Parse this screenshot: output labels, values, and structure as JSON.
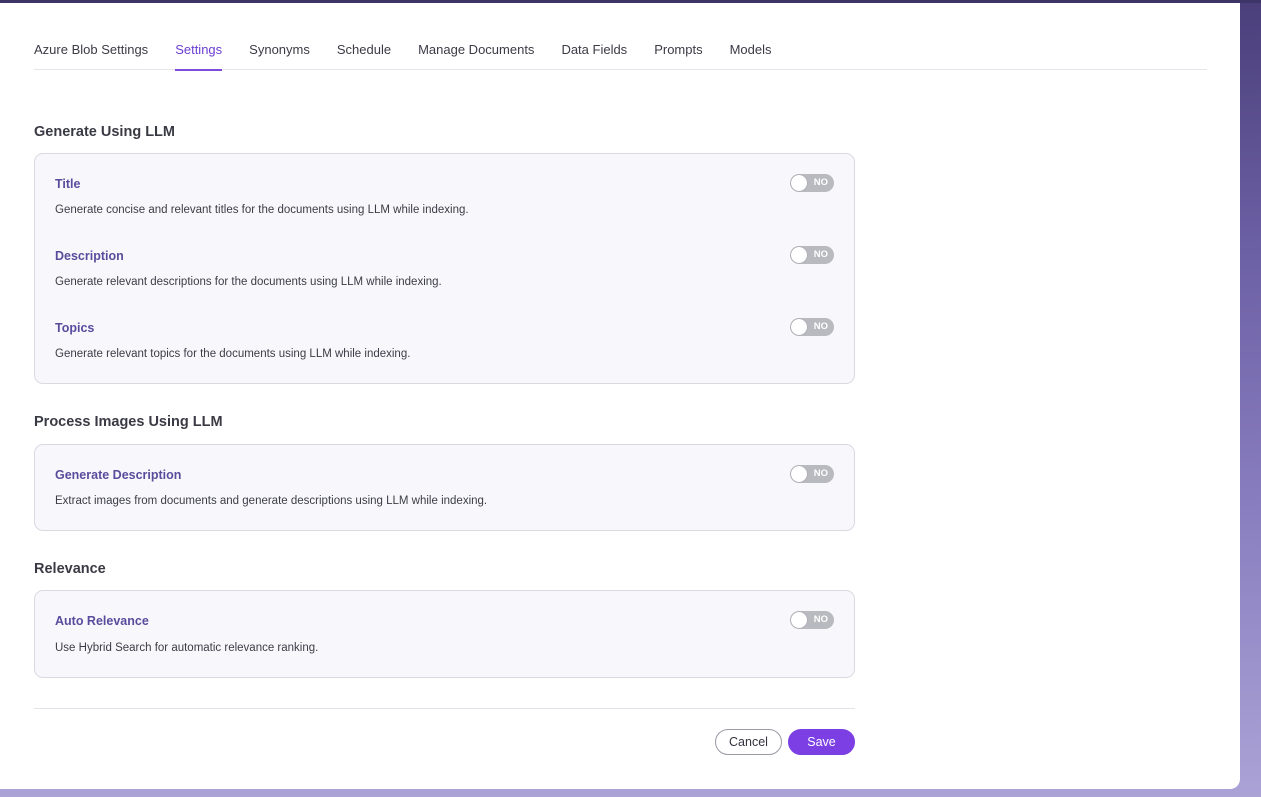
{
  "tabs": [
    {
      "label": "Azure Blob Settings",
      "active": false
    },
    {
      "label": "Settings",
      "active": true
    },
    {
      "label": "Synonyms",
      "active": false
    },
    {
      "label": "Schedule",
      "active": false
    },
    {
      "label": "Manage Documents",
      "active": false
    },
    {
      "label": "Data Fields",
      "active": false
    },
    {
      "label": "Prompts",
      "active": false
    },
    {
      "label": "Models",
      "active": false
    }
  ],
  "generate_llm": {
    "title": "Generate Using LLM",
    "items": [
      {
        "title": "Title",
        "description": "Generate concise and relevant titles for the documents using LLM while indexing.",
        "toggle": "NO"
      },
      {
        "title": "Description",
        "description": "Generate relevant descriptions for the documents using LLM while indexing.",
        "toggle": "NO"
      },
      {
        "title": "Topics",
        "description": "Generate relevant topics for the documents using LLM while indexing.",
        "toggle": "NO"
      }
    ]
  },
  "process_images": {
    "title": "Process Images Using LLM",
    "items": [
      {
        "title": "Generate Description",
        "description": "Extract images from documents and generate descriptions using LLM while indexing.",
        "toggle": "NO"
      }
    ]
  },
  "relevance": {
    "title": "Relevance",
    "items": [
      {
        "title": "Auto Relevance",
        "description": "Use Hybrid Search for automatic relevance ranking.",
        "toggle": "NO"
      }
    ]
  },
  "footer": {
    "cancel_label": "Cancel",
    "save_label": "Save"
  },
  "colors": {
    "accent": "#7b3fe4",
    "active_tab": "#6b3fd1",
    "item_title": "#5a4c9c",
    "toggle_off": "#b9b9c0"
  }
}
